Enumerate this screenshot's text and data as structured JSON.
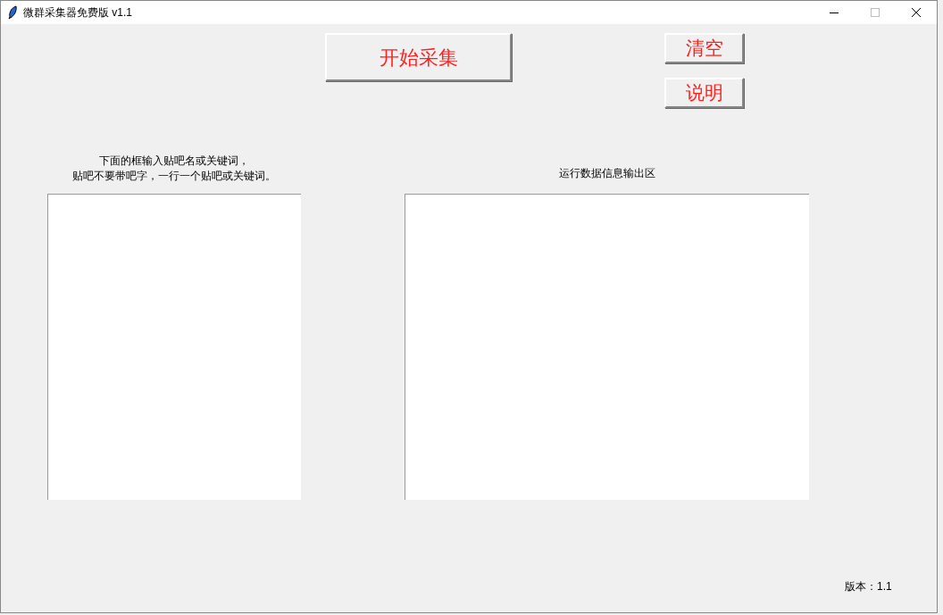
{
  "window": {
    "title": "微群采集器免费版 v1.1"
  },
  "buttons": [
    {
      "label": "开始采集",
      "kind": "main"
    },
    {
      "label": "清空",
      "kind": "side"
    },
    {
      "label": "说明",
      "kind": "side"
    }
  ],
  "input_panel": {
    "label_lines": [
      "下面的框输入贴吧名或关键词，",
      "贴吧不要带吧字，一行一个贴吧或关键词。"
    ]
  },
  "output_panel": {
    "label": "运行数据信息输出区"
  },
  "footer": {
    "version": "版本：1.1"
  }
}
